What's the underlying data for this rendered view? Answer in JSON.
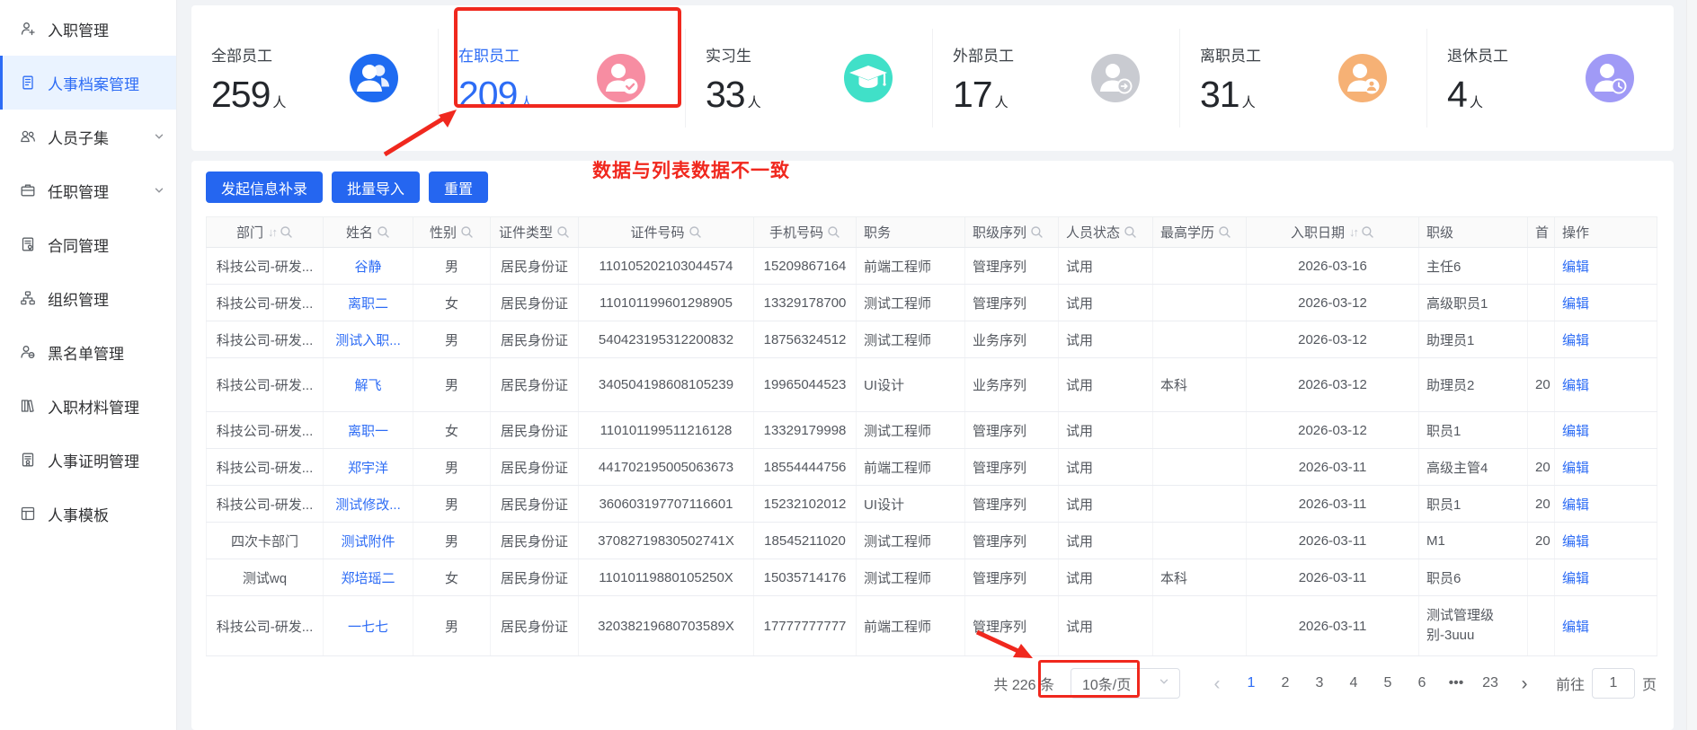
{
  "theme": {
    "accent": "#2566F0",
    "link": "#2D6CF5",
    "annotation_red": "#F0281E"
  },
  "sidebar": {
    "items": [
      {
        "label": "入职管理",
        "icon": "person-add-icon"
      },
      {
        "label": "人事档案管理",
        "icon": "document-icon",
        "active": true
      },
      {
        "label": "人员子集",
        "icon": "people-icon",
        "expandable": true
      },
      {
        "label": "任职管理",
        "icon": "briefcase-icon",
        "expandable": true
      },
      {
        "label": "合同管理",
        "icon": "contract-icon"
      },
      {
        "label": "组织管理",
        "icon": "org-chart-icon"
      },
      {
        "label": "黑名单管理",
        "icon": "person-block-icon"
      },
      {
        "label": "入职材料管理",
        "icon": "materials-icon"
      },
      {
        "label": "人事证明管理",
        "icon": "certificate-icon"
      },
      {
        "label": "人事模板",
        "icon": "template-icon"
      }
    ]
  },
  "stats": {
    "unit": "人",
    "cards": [
      {
        "label": "全部员工",
        "value": "259",
        "icon": "users-icon",
        "color": "#1E6BF1"
      },
      {
        "label": "在职员工",
        "value": "209",
        "icon": "user-check-icon",
        "color": "#F78DA2",
        "highlighted": true
      },
      {
        "label": "实习生",
        "value": "33",
        "icon": "graduation-cap-icon",
        "color": "#40E0C8"
      },
      {
        "label": "外部员工",
        "value": "17",
        "icon": "user-arrow-icon",
        "color": "#C9CBD1"
      },
      {
        "label": "离职员工",
        "value": "31",
        "icon": "user-badge-icon",
        "color": "#F6B175"
      },
      {
        "label": "退休员工",
        "value": "4",
        "icon": "user-clock-icon",
        "color": "#A09AF6"
      }
    ]
  },
  "annotations": {
    "note_text": "数据与列表数据不一致",
    "color": "#F0281E"
  },
  "toolbar": {
    "buttons": [
      "发起信息补录",
      "批量导入",
      "重置"
    ]
  },
  "table": {
    "edit_label": "编辑",
    "columns": [
      {
        "label": "部门",
        "sortable": true,
        "searchable": true
      },
      {
        "label": "姓名",
        "searchable": true
      },
      {
        "label": "性别",
        "searchable": true
      },
      {
        "label": "证件类型",
        "searchable": true
      },
      {
        "label": "证件号码",
        "searchable": true
      },
      {
        "label": "手机号码",
        "searchable": true
      },
      {
        "label": "职务"
      },
      {
        "label": "职级序列",
        "searchable": true
      },
      {
        "label": "人员状态",
        "searchable": true
      },
      {
        "label": "最高学历",
        "searchable": true
      },
      {
        "label": "入职日期",
        "sortable": true,
        "searchable": true
      },
      {
        "label": "职级"
      },
      {
        "label": "首"
      },
      {
        "label": "操作"
      }
    ],
    "rows": [
      {
        "dept": "科技公司-研发...",
        "name": "谷静",
        "gender": "男",
        "cert_type": "居民身份证",
        "cert_no": "110105202103044574",
        "phone": "15209867164",
        "job": "前端工程师",
        "series": "管理序列",
        "status": "试用",
        "education": "",
        "hire_date": "2026-03-16",
        "level": "主任6",
        "first": ""
      },
      {
        "dept": "科技公司-研发...",
        "name": "离职二",
        "gender": "女",
        "cert_type": "居民身份证",
        "cert_no": "110101199601298905",
        "phone": "13329178700",
        "job": "测试工程师",
        "series": "管理序列",
        "status": "试用",
        "education": "",
        "hire_date": "2026-03-12",
        "level": "高级职员1",
        "first": ""
      },
      {
        "dept": "科技公司-研发...",
        "name": "测试入职...",
        "gender": "男",
        "cert_type": "居民身份证",
        "cert_no": "540423195312200832",
        "phone": "18756324512",
        "job": "测试工程师",
        "series": "业务序列",
        "status": "试用",
        "education": "",
        "hire_date": "2026-03-12",
        "level": "助理员1",
        "first": ""
      },
      {
        "dept": "科技公司-研发...",
        "name": "解飞",
        "gender": "男",
        "cert_type": "居民身份证",
        "cert_no": "340504198608105239",
        "phone": "19965044523",
        "job": "UI设计",
        "series": "业务序列",
        "status": "试用",
        "education": "本科",
        "hire_date": "2026-03-12",
        "level": "助理员2",
        "first": "20"
      },
      {
        "dept": "科技公司-研发...",
        "name": "离职一",
        "gender": "女",
        "cert_type": "居民身份证",
        "cert_no": "110101199511216128",
        "phone": "13329179998",
        "job": "测试工程师",
        "series": "管理序列",
        "status": "试用",
        "education": "",
        "hire_date": "2026-03-12",
        "level": "职员1",
        "first": ""
      },
      {
        "dept": "科技公司-研发...",
        "name": "郑宇洋",
        "gender": "男",
        "cert_type": "居民身份证",
        "cert_no": "441702195005063673",
        "phone": "18554444756",
        "job": "前端工程师",
        "series": "管理序列",
        "status": "试用",
        "education": "",
        "hire_date": "2026-03-11",
        "level": "高级主管4",
        "first": "20"
      },
      {
        "dept": "科技公司-研发...",
        "name": "测试修改...",
        "gender": "男",
        "cert_type": "居民身份证",
        "cert_no": "360603197707116601",
        "phone": "15232102012",
        "job": "UI设计",
        "series": "管理序列",
        "status": "试用",
        "education": "",
        "hire_date": "2026-03-11",
        "level": "职员1",
        "first": "20"
      },
      {
        "dept": "四次卡部门",
        "name": "测试附件",
        "gender": "男",
        "cert_type": "居民身份证",
        "cert_no": "37082719830502741X",
        "phone": "18545211020",
        "job": "测试工程师",
        "series": "管理序列",
        "status": "试用",
        "education": "",
        "hire_date": "2026-03-11",
        "level": "M1",
        "first": "20"
      },
      {
        "dept": "测试wq",
        "name": "郑培瑶二",
        "gender": "女",
        "cert_type": "居民身份证",
        "cert_no": "11010119880105250X",
        "phone": "15035714176",
        "job": "测试工程师",
        "series": "管理序列",
        "status": "试用",
        "education": "本科",
        "hire_date": "2026-03-11",
        "level": "职员6",
        "first": ""
      },
      {
        "dept": "科技公司-研发...",
        "name": "一七七",
        "gender": "男",
        "cert_type": "居民身份证",
        "cert_no": "32038219680703589X",
        "phone": "17777777777",
        "job": "前端工程师",
        "series": "管理序列",
        "status": "试用",
        "education": "",
        "hire_date": "2026-03-11",
        "level": "测试管理级别-3uuu",
        "first": ""
      }
    ]
  },
  "pagination": {
    "total_text": "共 226 条",
    "page_size": "10条/页",
    "prev_icon": "‹",
    "next_icon": "›",
    "ellipsis": "•••",
    "pages": [
      "1",
      "2",
      "3",
      "4",
      "5",
      "6",
      "•••",
      "23"
    ],
    "current": "1",
    "goto_label": "前往",
    "goto_value": "1",
    "page_label": "页"
  }
}
